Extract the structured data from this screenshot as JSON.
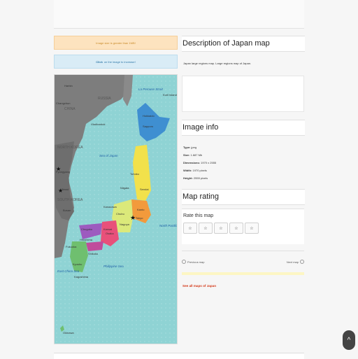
{
  "alerts": {
    "size_warning": "Image size is greater than 1MB!",
    "click_bold": "Click",
    "click_rest": "on the image to increase!"
  },
  "description": {
    "title": "Description of Japan map",
    "text": "Japan large regions map. Large regions map of Japan."
  },
  "image_info": {
    "title": "Image info",
    "rows": [
      {
        "label": "Type:",
        "value": "jpeg"
      },
      {
        "label": "Size:",
        "value": "1.687 Mb"
      },
      {
        "label": "Dimensions:",
        "value": "1970 x 2555"
      },
      {
        "label": "Width:",
        "value": "1970 pixels"
      },
      {
        "label": "Height:",
        "value": "2555 pixels"
      }
    ]
  },
  "rating": {
    "title": "Map rating",
    "subtitle": "Rate this map",
    "star_glyph": "☆"
  },
  "nav": {
    "prev": "Previous map",
    "next": "Next map",
    "all_maps": "See all maps of Japan"
  },
  "map_labels": {
    "countries": [
      "RUSSIA",
      "CHINA",
      "NORTH KOREA",
      "SOUTH KOREA"
    ],
    "seas": [
      "Sea of Japan",
      "North Pacific Ocean",
      "East China Sea",
      "Philippine Sea",
      "La Perouse Strait"
    ],
    "regions": [
      "Hokkaido",
      "Tohoku",
      "Kanto",
      "Chubu",
      "Kansai",
      "Chugoku",
      "Shikoku",
      "Kyushu",
      "Okinawa"
    ],
    "cities": [
      "Harbin",
      "Changchun",
      "Vladivostok",
      "Pyongyang",
      "Seoul",
      "Busan",
      "Sapporo",
      "Sendai",
      "Niigata",
      "Tokyo",
      "Yokohama",
      "Nagoya",
      "Kanazawa",
      "Osaka",
      "Kobe",
      "Kyoto",
      "Hiroshima",
      "Matsuyama",
      "Fukuoka",
      "Kitakyushu",
      "Kumamoto",
      "Kagoshima",
      "Naha",
      "Hamamatsu",
      "Okayama",
      "Kuril Islands (Russia)"
    ]
  },
  "scroll_top_icon": "^"
}
